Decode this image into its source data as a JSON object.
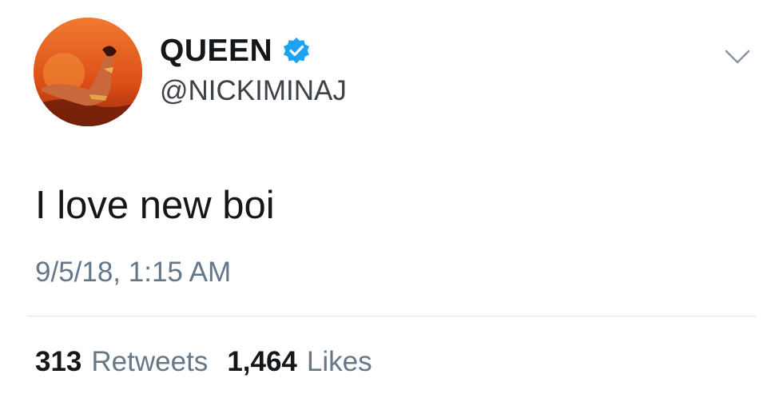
{
  "author": {
    "display_name": "QUEEN",
    "handle": "@NICKIMINAJ",
    "verified": true,
    "avatar_icon": "profile-photo"
  },
  "tweet": {
    "text": "I love new boi",
    "timestamp": "9/5/18, 1:15 AM"
  },
  "stats": {
    "retweets_count": "313",
    "retweets_label": "Retweets",
    "likes_count": "1,464",
    "likes_label": "Likes"
  },
  "colors": {
    "verified_badge": "#1da1f2",
    "secondary_text": "#657786",
    "primary_text": "#14171a",
    "divider": "#dfe3e6",
    "avatar_bg": "#e0561c"
  },
  "icons": {
    "menu": "chevron-down-icon",
    "verified": "verified-badge-icon"
  }
}
